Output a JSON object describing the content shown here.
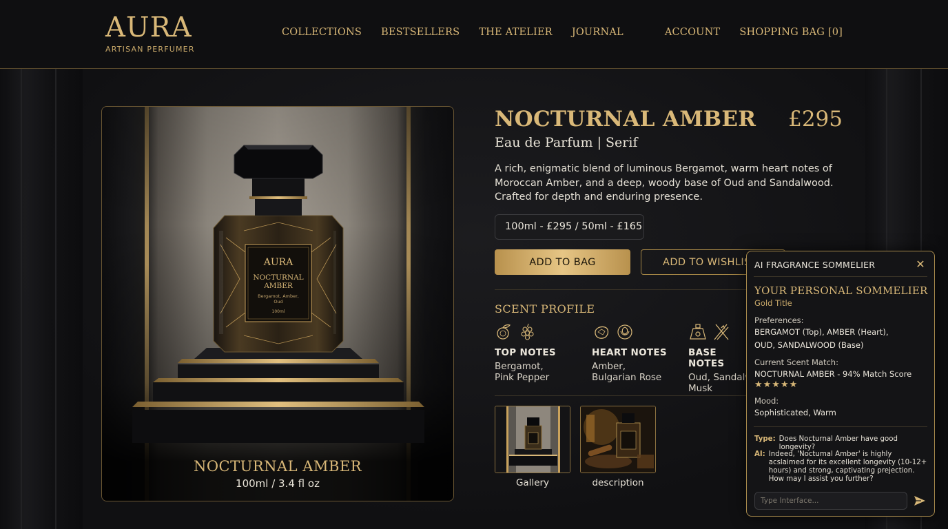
{
  "brand": {
    "name": "AURA",
    "tagline": "ARTISAN PERFUMER"
  },
  "nav": {
    "main": [
      "COLLECTIONS",
      "BESTSELLERS",
      "THE ATELIER",
      "JOURNAL"
    ],
    "account": "ACCOUNT",
    "bag": "SHOPPING BAG [0]"
  },
  "product_card": {
    "label_brand": "AURA",
    "label_name_1": "NOCTURNAL",
    "label_name_2": "AMBER",
    "label_notes": "Bergamot, Amber,",
    "label_notes_2": "Oud",
    "label_size": "100ml",
    "caption_title": "NOCTURNAL AMBER",
    "caption_size": "100ml / 3.4 fl oz"
  },
  "product": {
    "title": "NOCTURNAL AMBER",
    "price": "£295",
    "subtitle": "Eau de Parfum | Serif",
    "description": "A rich, enigmatic blend of luminous Bergamot, warm heart notes of Moroccan Amber, and a deep, woody base of Oud and Sandalwood. Crafted for depth and enduring presence.",
    "size_option": "100ml - £295 / 50ml - £165",
    "add_to_bag": "ADD TO BAG",
    "add_to_wishlist": "ADD TO WISHLIST"
  },
  "scent_profile": {
    "title": "SCENT PROFILE",
    "notes": [
      {
        "label": "TOP NOTES",
        "values_1": "Bergamot,",
        "values_2": "Pink Pepper",
        "icons": [
          "bergamot-icon",
          "pepper-icon"
        ]
      },
      {
        "label": "HEART NOTES",
        "values_1": "Amber,",
        "values_2": "Bulgarian Rose",
        "icons": [
          "amber-stone-icon",
          "rose-icon"
        ]
      },
      {
        "label": "BASE NOTES",
        "values_1": "Oud, Sandalwood,",
        "values_2": "Musk",
        "icons": [
          "musk-bottle-icon",
          "wood-sticks-icon"
        ]
      }
    ]
  },
  "thumbnails": [
    {
      "caption": "Gallery"
    },
    {
      "caption": "description"
    }
  ],
  "sommelier": {
    "header": "AI FRAGRANCE SOMMELIER",
    "title": "YOUR PERSONAL SOMMELIER",
    "subtitle": "Gold Title",
    "preferences_label": "Preferences:",
    "preferences_1": "BERGAMOT (Top),   AMBER (Heart),",
    "preferences_2": "OUD,   SANDALWOOD (Base)",
    "match_label": "Current Scent Match:",
    "match_value": "NOCTURNAL AMBER - 94% Match Score",
    "rating": 5,
    "stars": "★★★★★",
    "mood_label": "Mood:",
    "mood_value": "Sophisticated, Warm",
    "chat": [
      {
        "who": "Type:",
        "text": "Does Nocturnal Amber have good longevity?"
      },
      {
        "who": "AI:",
        "text": "Indeed, 'Noctumal Amber' is highly acslaimed for its excellent longevity (10-12+ hours) and strong, captivating prejection. How may I assist you further?"
      }
    ],
    "input_placeholder": "Type Interface..."
  },
  "colors": {
    "background": "#111113",
    "gold": "#d9b878",
    "gold_button": "#e6c585",
    "text": "#e9e4d8"
  }
}
